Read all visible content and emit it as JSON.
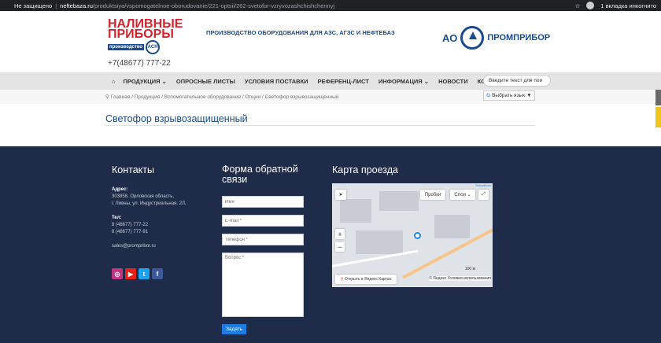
{
  "browser": {
    "security": "Не защищено",
    "domain": "neftebaza.ru",
    "path": "/produktsiya/vspomogatelnoe-oborudovanie/221-optsii/262-svetofor-vzryvozashchishchennyj",
    "incognito": "1 вкладка инкогнито"
  },
  "header": {
    "logo_line1": "НАЛИВНЫЕ",
    "logo_line2": "ПРИБОРЫ",
    "logo_badge": "производство",
    "logo_circle": "АСН",
    "phone": "+7(48677) 777-22",
    "slogan": "ПРОИЗВОДСТВО ОБОРУДОВАНИЯ ДЛЯ АЗС, АГЗС И НЕФТЕБАЗ",
    "brand_ao": "АО",
    "brand_name": "ПРОМПРИБОР"
  },
  "nav": {
    "items": [
      "ПРОДУКЦИЯ ⌄",
      "ОПРОСНЫЕ ЛИСТЫ",
      "УСЛОВИЯ ПОСТАВКИ",
      "РЕФЕРЕНЦ-ЛИСТ",
      "ИНФОРМАЦИЯ ⌄",
      "НОВОСТИ",
      "КОНТАКТЫ",
      "I"
    ],
    "translate_placeholder": "Введите текст для пои"
  },
  "breadcrumb": {
    "items": [
      "Главная",
      "Продукция",
      "Вспомогательное оборудование",
      "Опции",
      "Светофор взрывозащищенный"
    ],
    "sep": " / "
  },
  "gtranslate": {
    "label": "Выбрать язык",
    "arrow": "▼"
  },
  "page": {
    "title": "Светофор взрывозащищенный"
  },
  "footer": {
    "contacts": {
      "heading": "Контакты",
      "addr_label": "Адрес:",
      "addr1": "303858, Орловская область,",
      "addr2": "г. Ливны, ул. Индустриальная, 2Л,",
      "tel_label": "Тел:",
      "tel1": "8 (48677) 777-22",
      "tel2": "8 (48677) 777-91",
      "email": "sales@prompribor.ru"
    },
    "form": {
      "heading1": "Форма обратной",
      "heading2": "связи",
      "name_ph": "Имя",
      "email_ph": "E-mail *",
      "phone_ph": "Телефон *",
      "question_ph": "Вопрос *",
      "submit": "Задать"
    },
    "map": {
      "heading": "Карта проезда",
      "traffic": "Пробки",
      "layers": "Слои ⌄",
      "open": "Открыть в Яндекс Картах",
      "terms": "© Яндекс Условия использования",
      "scale": "100 м",
      "zoom_in": "+",
      "zoom_out": "−",
      "corner": "Sensations"
    }
  },
  "colors": {
    "accent": "#1a4b8f",
    "footer_bg": "#1e2c49",
    "logo_red": "#d6232b",
    "instagram": "#c13584",
    "youtube": "#e62117",
    "twitter": "#1da1f2",
    "facebook": "#3b5998"
  }
}
